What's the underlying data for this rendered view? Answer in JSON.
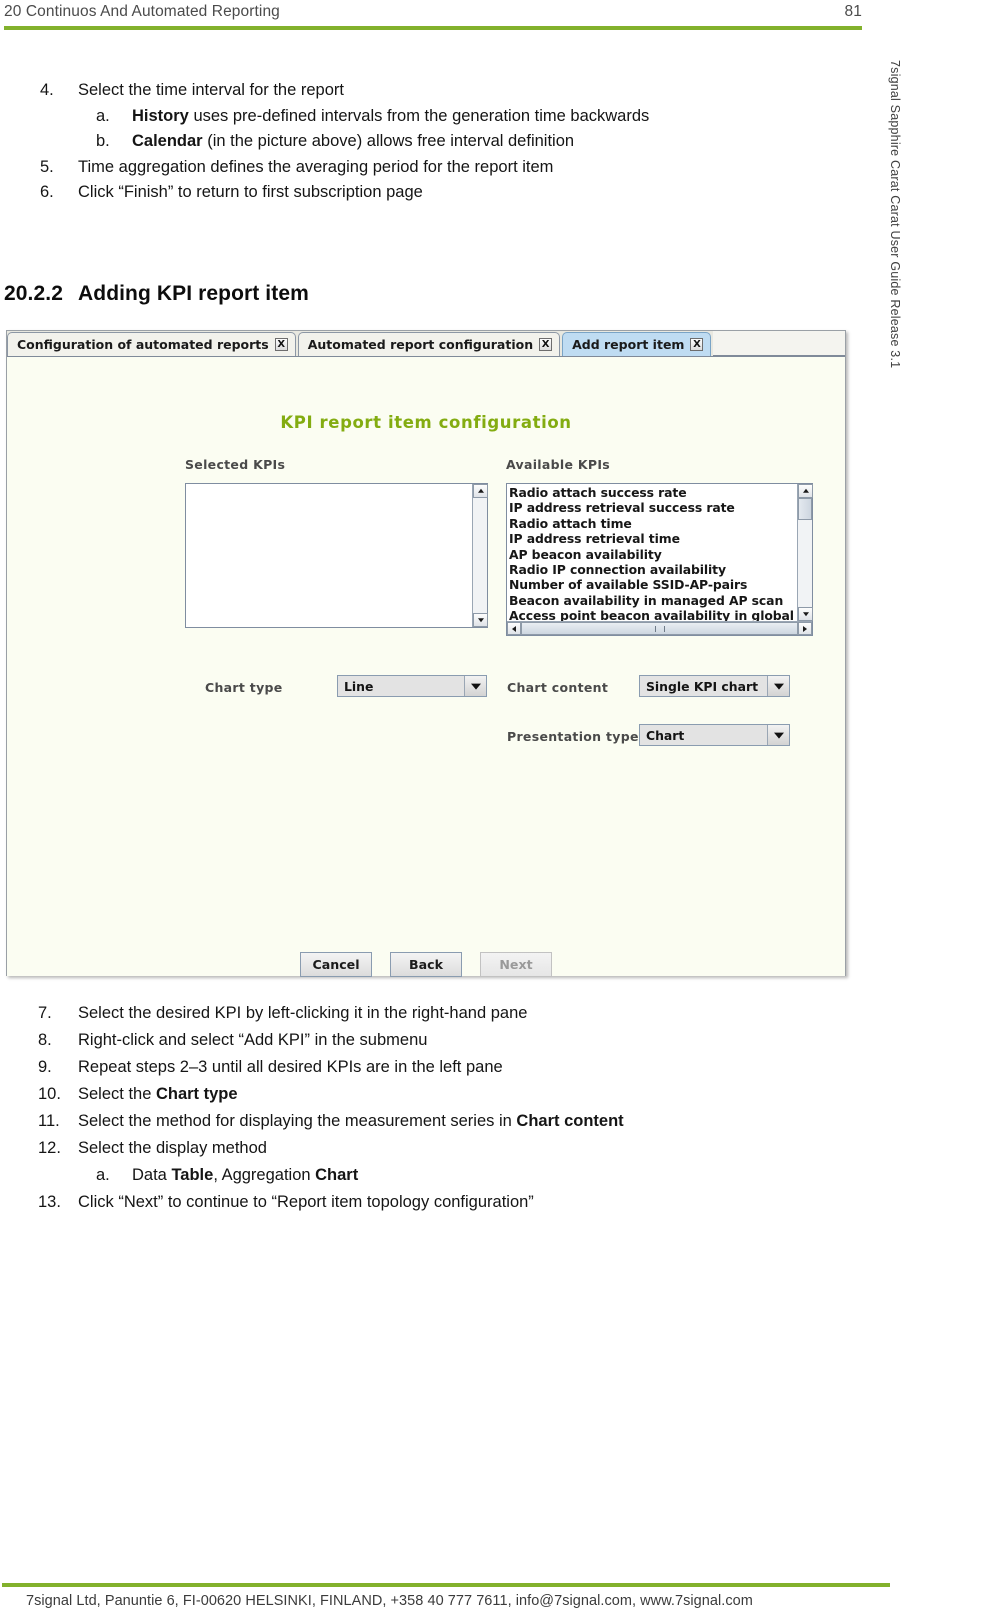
{
  "header": {
    "title": "20 Continuos And Automated Reporting",
    "page_number": "81",
    "rule_color": "#82b12c"
  },
  "sidebar": {
    "vertical_title": "7signal Sapphire Carat Carat User Guide Release 3.1"
  },
  "steps_upper": [
    {
      "num": "4.",
      "level": 1,
      "parts": [
        {
          "text": "Select the time interval for the report",
          "bold": false
        }
      ]
    },
    {
      "num": "a.",
      "level": 2,
      "parts": [
        {
          "text": "History",
          "bold": true
        },
        {
          "text": " uses pre-defined intervals from the generation time backwards",
          "bold": false
        }
      ]
    },
    {
      "num": "b.",
      "level": 2,
      "parts": [
        {
          "text": "Calendar",
          "bold": true
        },
        {
          "text": " (in the picture above) allows free interval definition",
          "bold": false
        }
      ]
    },
    {
      "num": "5.",
      "level": 1,
      "parts": [
        {
          "text": "Time aggregation defines the averaging period for the report item",
          "bold": false
        }
      ]
    },
    {
      "num": "6.",
      "level": 1,
      "parts": [
        {
          "text": "Click “Finish” to return to first subscription page",
          "bold": false
        }
      ]
    }
  ],
  "section": {
    "number": "20.2.2",
    "title": "Adding KPI report item"
  },
  "app": {
    "tabs": [
      {
        "label": "Configuration of automated reports",
        "close": "X",
        "active": false
      },
      {
        "label": "Automated report configuration",
        "close": "X",
        "active": false
      },
      {
        "label": "Add report item",
        "close": "X",
        "active": true
      }
    ],
    "title": "KPI report item configuration",
    "title_color": "#83ac11",
    "labels": {
      "selected_kpis": "Selected KPIs",
      "available_kpis": "Available KPIs",
      "chart_type": "Chart type",
      "chart_content": "Chart content",
      "presentation_type": "Presentation type"
    },
    "selected_kpis_items": [],
    "available_kpis_items": [
      "Radio attach success rate",
      "IP address retrieval success rate",
      "Radio attach time",
      "IP address retrieval time",
      "AP beacon availability",
      "Radio IP connection availability",
      "Number of available SSID-AP-pairs",
      "Beacon availability in managed AP scan",
      "Access point beacon availability in global AP"
    ],
    "combos": {
      "chart_type_value": "Line",
      "chart_content_value": "Single KPI chart",
      "presentation_type_value": "Chart"
    },
    "buttons": [
      {
        "label": "Cancel",
        "disabled": false
      },
      {
        "label": "Back",
        "disabled": false
      },
      {
        "label": "Next",
        "disabled": true
      }
    ]
  },
  "steps_lower": [
    {
      "num": "7.",
      "level": 1,
      "parts": [
        {
          "text": "Select the desired KPI by left-clicking it in the right-hand pane",
          "bold": false
        }
      ]
    },
    {
      "num": "8.",
      "level": 1,
      "parts": [
        {
          "text": "Right-click and select “Add KPI” in the submenu",
          "bold": false
        }
      ]
    },
    {
      "num": "9.",
      "level": 1,
      "parts": [
        {
          "text": "Repeat steps 2–3 until all desired KPIs are in the left pane",
          "bold": false
        }
      ]
    },
    {
      "num": "10.",
      "level": 1,
      "parts": [
        {
          "text": "Select the ",
          "bold": false
        },
        {
          "text": "Chart type",
          "bold": true
        }
      ]
    },
    {
      "num": "11.",
      "level": 1,
      "parts": [
        {
          "text": "Select the method for displaying the measurement series in ",
          "bold": false
        },
        {
          "text": "Chart content",
          "bold": true
        }
      ]
    },
    {
      "num": "12.",
      "level": 1,
      "parts": [
        {
          "text": "Select the display method",
          "bold": false
        }
      ]
    },
    {
      "num": "a.",
      "level": 2,
      "parts": [
        {
          "text": "Data ",
          "bold": false
        },
        {
          "text": "Table",
          "bold": true
        },
        {
          "text": ", Aggregation ",
          "bold": false
        },
        {
          "text": "Chart",
          "bold": true
        }
      ]
    },
    {
      "num": "13.",
      "level": 1,
      "parts": [
        {
          "text": "Click “Next” to continue to “Report item topology configuration”",
          "bold": false
        }
      ]
    }
  ],
  "footer": {
    "text": "7signal Ltd, Panuntie 6, FI-00620 HELSINKI, FINLAND, +358 40 777 7611, info@7signal.com, www.7signal.com",
    "rule_color": "#82b12c"
  }
}
